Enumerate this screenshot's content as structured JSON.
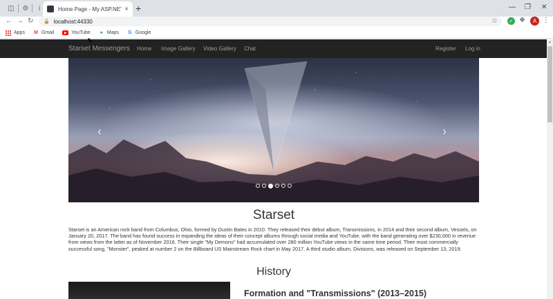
{
  "browser": {
    "tab_title": "Home Page - My ASP.NET Applic",
    "url": "localhost:44330",
    "avatar_letter": "A",
    "bookmarks": [
      "Apps",
      "Gmail",
      "YouTube",
      "Maps",
      "Google"
    ]
  },
  "site": {
    "brand": "Starset Messengers",
    "nav": [
      "Home",
      "Image Gallery",
      "Video Gallery",
      "Chat"
    ],
    "auth": [
      "Register",
      "Log in"
    ]
  },
  "carousel": {
    "slide_count": 6,
    "active_index": 2
  },
  "main": {
    "title": "Starset",
    "intro": "Starset is an American rock band from Columbus, Ohio, formed by Dustin Bates in 2010. They released their debut album, Transmissions, in 2014 and their second album, Vessels, on January 20, 2017. The band has found success in expanding the ideas of their concept albums through social media and YouTube, with the band generating over $230,000 in revenue from views from the latter as of November 2016. Their single \"My Demons\" had accumulated over 280 million YouTube views in the same time period. Their most commercially successful song, \"Monster\", peaked at number 2 on the Billboard US Mainstream Rock chart in May 2017. A third studio album, Divisions, was released on September 13, 2019.",
    "history_title": "History",
    "section_title": "Formation and \"Transmissions\" (2013–2015)"
  },
  "colors": {
    "navbar_bg": "#222222",
    "nav_text": "#9d9d9d",
    "text": "#333333"
  }
}
